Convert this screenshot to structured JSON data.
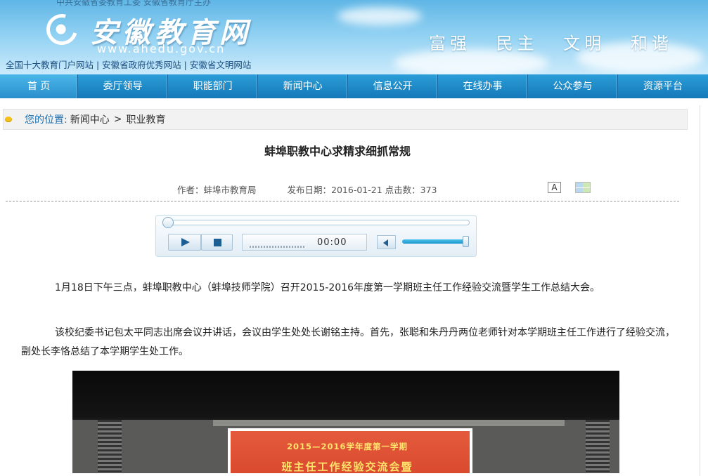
{
  "header": {
    "top_line": "中共安徽省委教育工委  安徽省教育厅主办",
    "logo_text": "安徽教育网",
    "logo_url": "www.ahedu.gov.cn",
    "slogan": [
      "富强",
      "民主",
      "文明",
      "和谐"
    ],
    "honors": "全国十大教育门户网站 | 安徽省政府优秀网站 | 安徽省文明网站"
  },
  "nav": {
    "items": [
      "首 页",
      "委厅领导",
      "职能部门",
      "新闻中心",
      "信息公开",
      "在线办事",
      "公众参与",
      "资源平台"
    ]
  },
  "breadcrumb": {
    "label": "您的位置:",
    "path": [
      "新闻中心",
      "职业教育"
    ],
    "separator": ">"
  },
  "article": {
    "title": "蚌埠职教中心求精求细抓常规",
    "author": "作者：蚌埠市教育局",
    "publish": "发布日期：2016-01-21 点击数：373",
    "font_button": "A",
    "paragraphs": [
      "1月18日下午三点，蚌埠职教中心（蚌埠技师学院）召开2015-2016年度第一学期班主任工作经验交流暨学生工作总结大会。",
      "该校纪委书记包太平同志出席会议并讲话，会议由学生处处长谢铭主持。首先，张聪和朱丹丹两位老师针对本学期班主任工作进行了经验交流，副处长李恪总结了本学期学生处工作。"
    ]
  },
  "player": {
    "time": "00:00",
    "progress": 0,
    "volume": 1.0
  },
  "photo": {
    "screen_line1": "2015—2016学年度第一学期",
    "screen_line2": "班主任工作经验交流会暨"
  },
  "colors": {
    "nav_bg": "#1a86c6",
    "link_blue": "#1a6fb0",
    "breadcrumb_dot": "#f4c21a"
  }
}
